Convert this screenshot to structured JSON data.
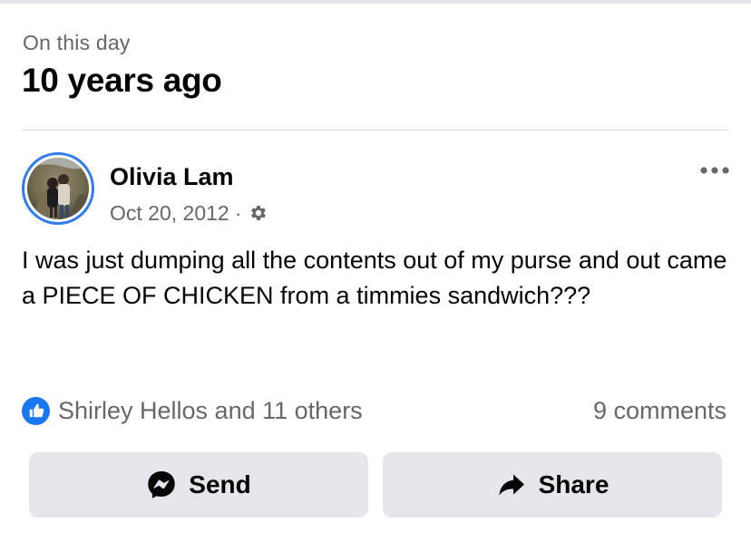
{
  "memory": {
    "label": "On this day",
    "title": "10 years ago"
  },
  "post": {
    "author": "Olivia Lam",
    "date": "Oct 20, 2012",
    "separator": "·",
    "privacy_icon": "gear-icon",
    "text": "I was just dumping all the contents out of my purse and out came a PIECE OF CHICKEN from a timmies sandwich???",
    "reactions_text": "Shirley Hellos and 11 others",
    "comments_text": "9 comments"
  },
  "actions": {
    "send_label": "Send",
    "share_label": "Share"
  },
  "colors": {
    "accent": "#2f7bf2",
    "like_blue": "#1877f2",
    "button_bg": "#e4e6eb",
    "secondary_text": "#65676b"
  }
}
